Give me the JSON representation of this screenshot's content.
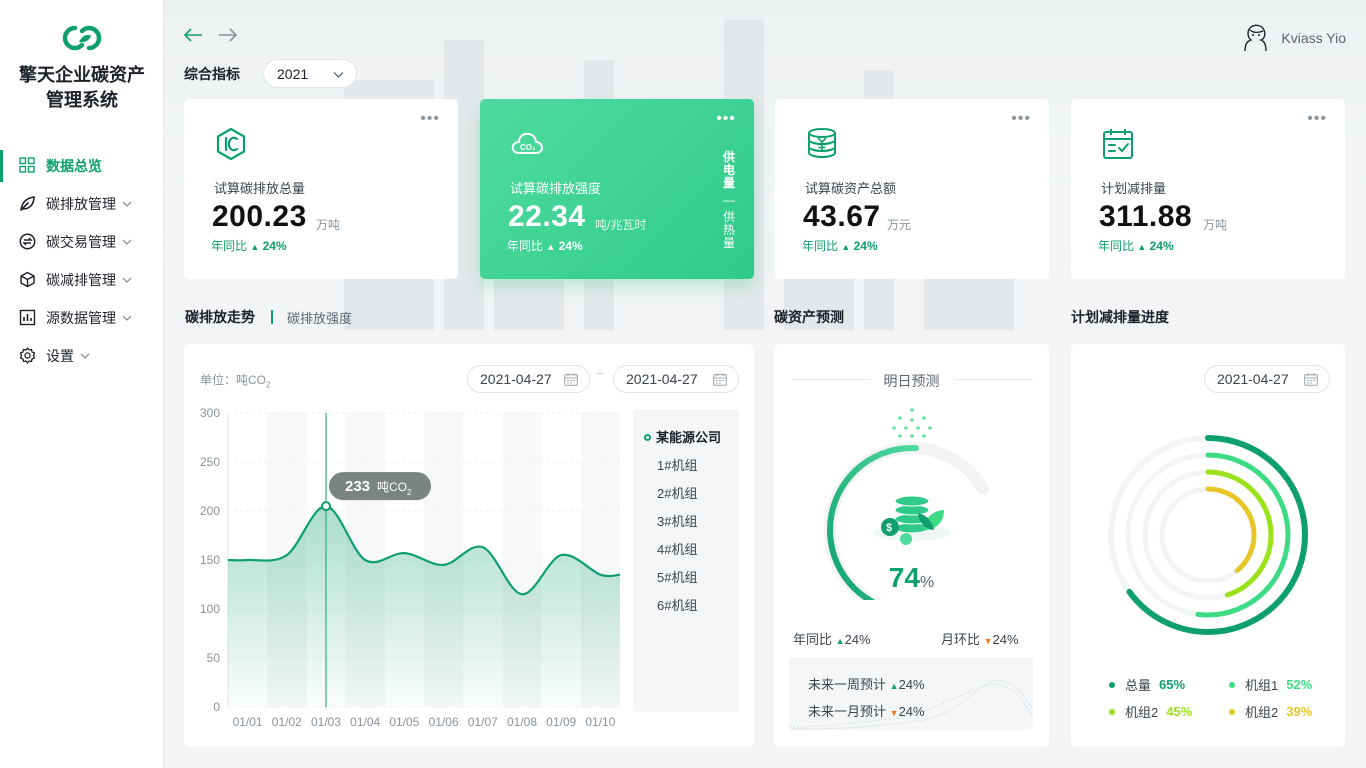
{
  "app": {
    "title_line1": "擎天企业碳资产",
    "title_line2": "管理系统"
  },
  "sidebar": {
    "items": [
      {
        "label": "数据总览",
        "icon": "grid-icon",
        "active": true
      },
      {
        "label": "碳排放管理",
        "icon": "leaf-icon"
      },
      {
        "label": "碳交易管理",
        "icon": "exchange-icon"
      },
      {
        "label": "碳减排管理",
        "icon": "cube-icon"
      },
      {
        "label": "源数据管理",
        "icon": "bar-chart-icon"
      },
      {
        "label": "设置",
        "icon": "gear-icon"
      }
    ]
  },
  "user": {
    "name": "Kviass Yio"
  },
  "overview": {
    "title": "综合指标",
    "year": "2021"
  },
  "kpis": [
    {
      "label": "试算碳排放总量",
      "value": "200.23",
      "unit": "万吨",
      "yoy_label": "年同比",
      "yoy_value": "24%",
      "icon": "c-hexagon-icon"
    },
    {
      "label": "试算碳排放强度",
      "value": "22.34",
      "unit": "吨/兆瓦时",
      "yoy_label": "年同比",
      "yoy_value": "24%",
      "icon": "cloud-co2-icon",
      "side_tab_active": "供电量",
      "side_tab_sep": "—",
      "side_tab_other": "供热量"
    },
    {
      "label": "试算碳资产总额",
      "value": "43.67",
      "unit": "万元",
      "yoy_label": "年同比",
      "yoy_value": "24%",
      "icon": "coins-yen-icon"
    },
    {
      "label": "计划减排量",
      "value": "311.88",
      "unit": "万吨",
      "yoy_label": "年同比",
      "yoy_value": "24%",
      "icon": "calendar-check-icon"
    }
  ],
  "trend": {
    "tab_active": "碳排放走势",
    "tab_other": "碳排放强度",
    "unit_label": "单位：吨CO",
    "unit_sub": "2",
    "date_from": "2021-04-27",
    "date_to": "2021-04-27",
    "tooltip_value": "233",
    "tooltip_unit": "吨CO",
    "tooltip_sub": "2",
    "legend": [
      "某能源公司",
      "1#机组",
      "2#机组",
      "3#机组",
      "4#机组",
      "5#机组",
      "6#机组"
    ]
  },
  "chart_data": {
    "type": "area",
    "categories": [
      "01/01",
      "01/02",
      "01/03",
      "01/04",
      "01/05",
      "01/06",
      "01/07",
      "01/08",
      "01/09",
      "01/10"
    ],
    "series": [
      {
        "name": "某能源公司",
        "values": [
          150,
          155,
          205,
          150,
          157,
          145,
          163,
          115,
          155,
          135
        ]
      }
    ],
    "yticks": [
      0,
      50,
      100,
      150,
      200,
      250,
      300
    ],
    "ylim": [
      0,
      300
    ],
    "highlight": {
      "category": "01/03",
      "value": 233
    },
    "grid": true
  },
  "asset": {
    "title": "碳资产预测",
    "gauge_title": "明日预测",
    "percent": "74",
    "percent_sign": "%",
    "percent_value": 74,
    "yoy_label": "年同比",
    "yoy_value": "24%",
    "mom_label": "月环比",
    "mom_value": "24%",
    "week_label": "未来一周预计",
    "week_value": "24%",
    "month_label": "未来一月预计",
    "month_value": "24%"
  },
  "reduction": {
    "title": "计划减排量进度",
    "date": "2021-04-27",
    "rings": [
      {
        "label": "总量",
        "value": "65%",
        "fraction": 0.65,
        "color": "#0e9f6e"
      },
      {
        "label": "机组1",
        "value": "52%",
        "fraction": 0.52,
        "color": "#3ddc84"
      },
      {
        "label": "机组2",
        "value": "45%",
        "fraction": 0.45,
        "color": "#9be21b"
      },
      {
        "label": "机组2",
        "value": "39%",
        "fraction": 0.39,
        "color": "#e6c727"
      }
    ]
  },
  "colors": {
    "brand": "#0e9f6e",
    "brand_light": "#3ddc84",
    "warning": "#f47a1f"
  }
}
